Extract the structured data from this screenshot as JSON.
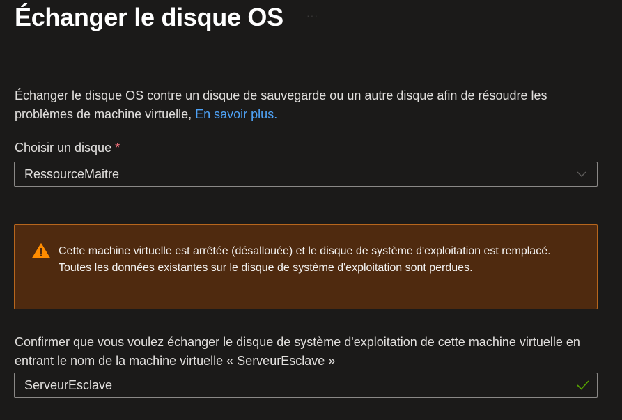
{
  "panel": {
    "title": "Échanger le disque OS",
    "more_icon": "ellipsis-icon",
    "description": "Échanger le disque OS contre un disque de sauvegarde ou un autre disque afin de résoudre les problèmes de machine virtuelle, ",
    "learn_more_link": "En savoir plus."
  },
  "disk_select": {
    "label": "Choisir un disque",
    "required_marker": "*",
    "selected_value": "RessourceMaitre",
    "icon": "chevron-down-icon"
  },
  "warning": {
    "icon": "warning-icon",
    "text": "Cette machine virtuelle est arrêtée (désallouée) et le disque de système d'exploitation est remplacé. Toutes les données existantes sur le disque de système d'exploitation sont perdues."
  },
  "confirm": {
    "instruction": "Confirmer que vous voulez échanger le disque de système d'exploitation de cette machine virtuelle en entrant le nom de la machine virtuelle « ServeurEsclave »",
    "value": "ServeurEsclave",
    "icon": "checkmark-icon"
  },
  "colors": {
    "background": "#1b1a19",
    "link": "#4fa3f7",
    "warning_bg": "#4f2a0f",
    "warning_border": "#b7661d",
    "warning_icon": "#ff8c00",
    "valid_check": "#57a300",
    "required": "#f1707b"
  }
}
